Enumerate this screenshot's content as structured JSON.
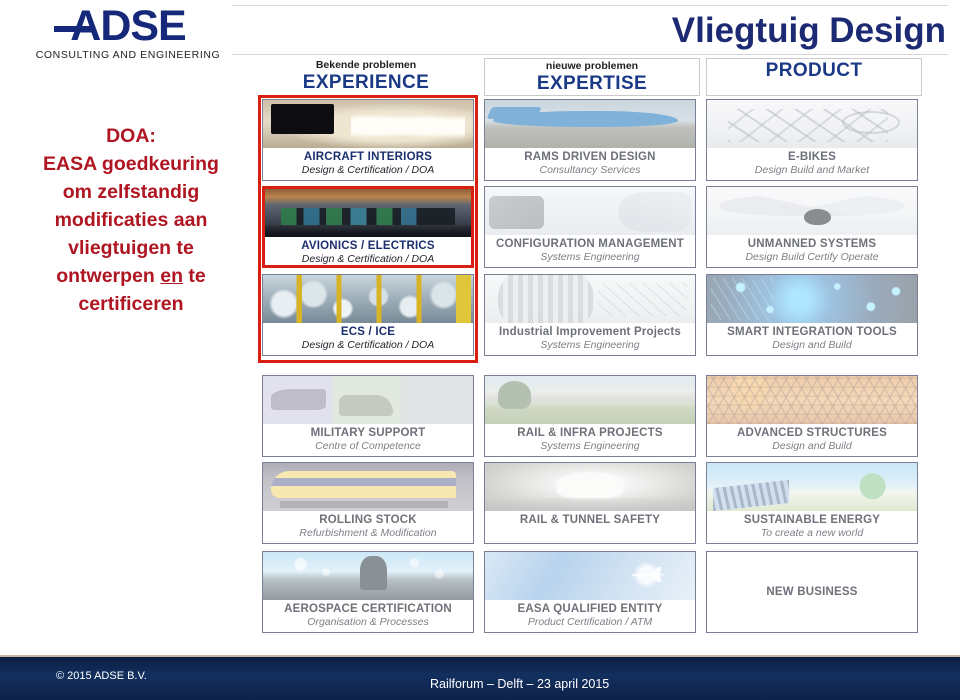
{
  "brand": {
    "logo_text": "ADSE",
    "logo_tagline": "CONSULTING AND ENGINEERING",
    "logo_color": "#16287a"
  },
  "title": {
    "main": "Vliegtuig Design",
    "color": "#1b2a72"
  },
  "left_statement": {
    "line1": "DOA:",
    "line2": "EASA goedkeuring",
    "line3": "om zelfstandig",
    "line4": "modificaties aan",
    "line5": "vliegtuigen te",
    "line6_a": "ontwerpen ",
    "line6_u": "en",
    "line6_b": " te",
    "line7": "certificeren",
    "color": "#b01621"
  },
  "columns": [
    {
      "sub": "Bekende problemen",
      "main": "EXPERIENCE",
      "boxed": false
    },
    {
      "sub": "nieuwe problemen",
      "main": "EXPERTISE",
      "boxed": true
    },
    {
      "sub": "",
      "main": "PRODUCT",
      "boxed": true
    }
  ],
  "highlight": {
    "color": "#d81f12",
    "note": "red frame around EXPERIENCE column rows 1-3 and around AVIONICS / ELECTRICS card"
  },
  "cards": [
    {
      "col": 0,
      "row": 0,
      "title": "AIRCRAFT INTERIORS",
      "subtitle": "Design & Certification  / DOA",
      "art": "ph-interior",
      "style": "strong",
      "red": false
    },
    {
      "col": 0,
      "row": 1,
      "title": "AVIONICS / ELECTRICS",
      "subtitle": "Design & Certification / DOA",
      "art": "ph-cockpit",
      "style": "strong",
      "red": true
    },
    {
      "col": 0,
      "row": 2,
      "title": "ECS / ICE",
      "subtitle": "Design  & Certification / DOA",
      "art": "ph-ice",
      "style": "strong",
      "red": false
    },
    {
      "col": 0,
      "row": 3,
      "title": "MILITARY SUPPORT",
      "subtitle": "Centre of Competence",
      "art": "ph-military",
      "style": "faded",
      "red": false
    },
    {
      "col": 0,
      "row": 4,
      "title": "ROLLING STOCK",
      "subtitle": "Refurbishment & Modification",
      "art": "ph-train",
      "style": "faded",
      "red": false
    },
    {
      "col": 0,
      "row": 5,
      "title": "AEROSPACE CERTIFICATION",
      "subtitle": "Organisation & Processes",
      "art": "ph-aero",
      "style": "faded2",
      "red": false
    },
    {
      "col": 1,
      "row": 0,
      "title": "RAMS DRIVEN DESIGN",
      "subtitle": "Consultancy Services",
      "art": "ph-plane",
      "style": "faded2",
      "red": false
    },
    {
      "col": 1,
      "row": 1,
      "title": "CONFIGURATION MANAGEMENT",
      "subtitle": "Systems Engineering",
      "art": "ph-cad",
      "style": "faded",
      "red": false
    },
    {
      "col": 1,
      "row": 2,
      "title": "Industrial  Improvement  Projects",
      "subtitle": "Systems Engineering",
      "art": "ph-gear",
      "style": "faded",
      "red": false
    },
    {
      "col": 1,
      "row": 3,
      "title": "RAIL & INFRA PROJECTS",
      "subtitle": "Systems Engineering",
      "art": "ph-rail",
      "style": "faded",
      "red": false
    },
    {
      "col": 1,
      "row": 4,
      "title": "RAIL & TUNNEL SAFETY",
      "subtitle": "",
      "art": "ph-tunnel",
      "style": "faded",
      "red": false
    },
    {
      "col": 1,
      "row": 5,
      "title": "EASA QUALIFIED ENTITY",
      "subtitle": "Product Certification / ATM",
      "art": "ph-easa",
      "style": "faded2",
      "red": false
    },
    {
      "col": 2,
      "row": 0,
      "title": "E-BIKES",
      "subtitle": "Design Build and Market",
      "art": "ph-ebike",
      "style": "faded2",
      "red": false
    },
    {
      "col": 2,
      "row": 1,
      "title": "UNMANNED SYSTEMS",
      "subtitle": "Design Build Certify Operate",
      "art": "ph-drone",
      "style": "faded2",
      "red": false
    },
    {
      "col": 2,
      "row": 2,
      "title": "SMART INTEGRATION TOOLS",
      "subtitle": "Design and Build",
      "art": "ph-smart",
      "style": "faded",
      "red": false
    },
    {
      "col": 2,
      "row": 3,
      "title": "ADVANCED STRUCTURES",
      "subtitle": "Design and Build",
      "art": "ph-honeycomb",
      "style": "faded",
      "red": false
    },
    {
      "col": 2,
      "row": 4,
      "title": "SUSTAINABLE ENERGY",
      "subtitle": "To create a new world",
      "art": "ph-energy",
      "style": "faded",
      "red": false
    },
    {
      "col": 2,
      "row": 5,
      "title": "NEW BUSINESS",
      "subtitle": "",
      "art": "",
      "style": "empty",
      "red": false
    }
  ],
  "footer": {
    "copyright": "© 2015 ADSE B.V.",
    "event": "Railforum – Delft – 23 april 2015",
    "background": "#0b1b3f"
  }
}
